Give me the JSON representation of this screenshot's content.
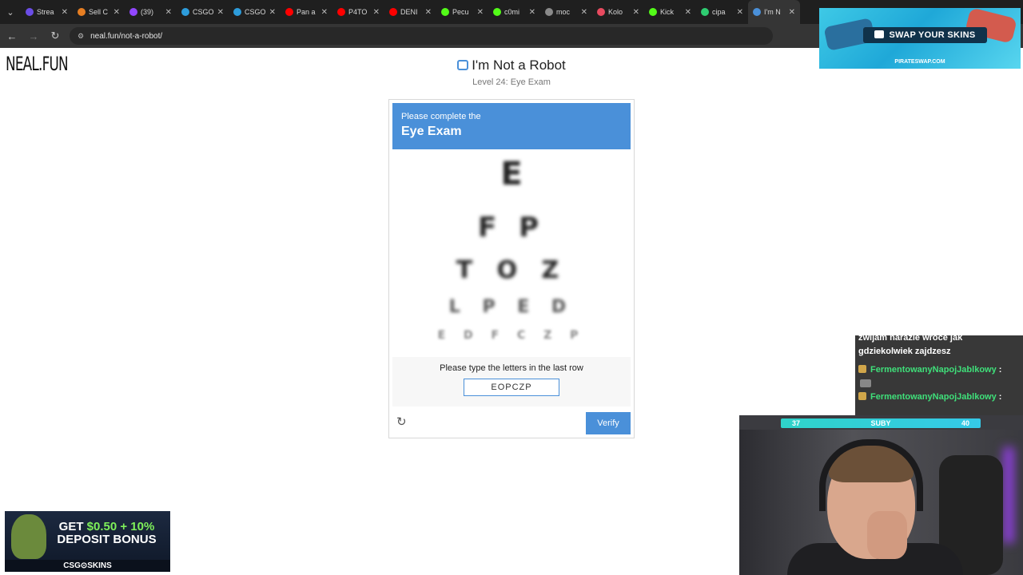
{
  "browser": {
    "tabs": [
      {
        "title": "Strea",
        "color": "#6b4de6"
      },
      {
        "title": "Sell C",
        "color": "#e67e22"
      },
      {
        "title": "(39)",
        "color": "#9146ff"
      },
      {
        "title": "CSGO",
        "color": "#2d9cdb"
      },
      {
        "title": "CSGO",
        "color": "#2d9cdb"
      },
      {
        "title": "Pan a",
        "color": "#ff0000"
      },
      {
        "title": "P4TO",
        "color": "#ff0000"
      },
      {
        "title": "DENI",
        "color": "#ff0000"
      },
      {
        "title": "Pecu",
        "color": "#53fc18"
      },
      {
        "title": "c0mi",
        "color": "#53fc18"
      },
      {
        "title": "moc",
        "color": "#8a8a8a"
      },
      {
        "title": "Kolo",
        "color": "#e84a5f"
      },
      {
        "title": "Kick",
        "color": "#53fc18"
      },
      {
        "title": "cipa",
        "color": "#2ecc71"
      },
      {
        "title": "I'm N",
        "color": "#4a90d9"
      }
    ],
    "url": "neal.fun/not-a-robot/"
  },
  "page": {
    "brand": "NEAL.FUN",
    "title": "I'm Not a Robot",
    "level": "Level 24: Eye Exam"
  },
  "captcha": {
    "header_line1": "Please complete the",
    "header_line2": "Eye Exam",
    "chart_rows": [
      "E",
      "F P",
      "T O Z",
      "L P E D",
      "E D F C Z P"
    ],
    "prompt": "Please type the letters in the last row",
    "answer_value": "EOPCZP",
    "verify_label": "Verify",
    "refresh_icon": "↻"
  },
  "overlays": {
    "top_ad": {
      "text": "SWAP YOUR SKINS",
      "url": "PIRATESWAP.COM"
    },
    "chat": {
      "message_line1": "zwijam narazie wroce jak",
      "message_line2": "gdziekolwiek zajdzesz",
      "users": [
        "FermentowanyNapojJablkowy",
        "FermentowanyNapojJablkowy"
      ]
    },
    "webcam_bar": {
      "left": "37",
      "name": "SUBY",
      "right": "40"
    },
    "bottom_ad": {
      "line1": "GET ",
      "highlight": "$0.50 + 10%",
      "line2": "DEPOSIT BONUS",
      "brand": "CSG⊙SKINS"
    }
  }
}
